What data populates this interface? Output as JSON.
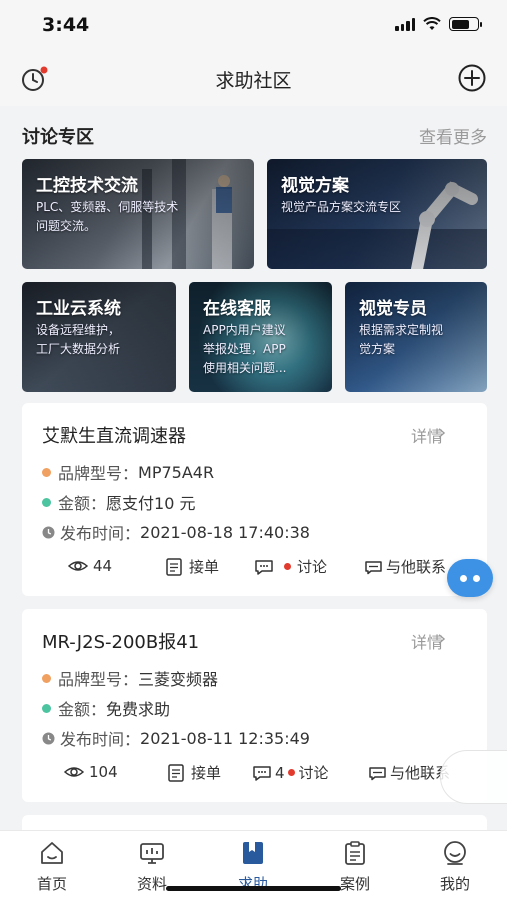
{
  "status": {
    "time": "3:44"
  },
  "nav": {
    "title": "求助社区"
  },
  "section": {
    "title": "讨论专区",
    "more": "查看更多"
  },
  "tiles": [
    {
      "title": "工控技术交流",
      "desc": "PLC、变频器、伺服等技术\n问题交流。"
    },
    {
      "title": "视觉方案",
      "desc": "视觉产品方案交流专区"
    },
    {
      "title": "工业云系统",
      "desc": "设备远程维护，\n工厂大数据分析"
    },
    {
      "title": "在线客服",
      "desc": "APP内用户建议\n举报处理，APP\n使用相关问题..."
    },
    {
      "title": "视觉专员",
      "desc": "根据需求定制视\n觉方案"
    }
  ],
  "cards": [
    {
      "title": "艾默生直流调速器",
      "detail": "详情",
      "brand_label": "品牌型号：",
      "brand_value": "MP75A4R",
      "amount_label": "金额：",
      "amount_value": "愿支付10 元",
      "time_label": "发布时间：",
      "time_value": "2021-08-18 17:40:38",
      "views": "44",
      "order": "接单",
      "discuss_count": "",
      "discuss": "讨论",
      "contact": "与他联系"
    },
    {
      "title": "MR-J2S-200B报41",
      "detail": "详情",
      "brand_label": "品牌型号：",
      "brand_value": "三菱变频器",
      "amount_label": "金额：",
      "amount_value": "免费求助",
      "time_label": "发布时间：",
      "time_value": "2021-08-11 12:35:49",
      "views": "104",
      "order": "接单",
      "discuss_count": "4",
      "discuss": "讨论",
      "contact": "与他联系"
    }
  ],
  "tabs": [
    {
      "label": "首页",
      "icon": "home-icon"
    },
    {
      "label": "资料",
      "icon": "monitor-icon"
    },
    {
      "label": "求助",
      "icon": "bookmark-icon",
      "active": true
    },
    {
      "label": "案例",
      "icon": "clipboard-icon"
    },
    {
      "label": "我的",
      "icon": "smile-icon"
    }
  ],
  "colors": {
    "brand_dot": "#f0a060",
    "amount_dot": "#4cc4a0",
    "accent": "#2a5a9e",
    "chat_fab": "#3d92e6",
    "badge": "#e23b2e"
  }
}
